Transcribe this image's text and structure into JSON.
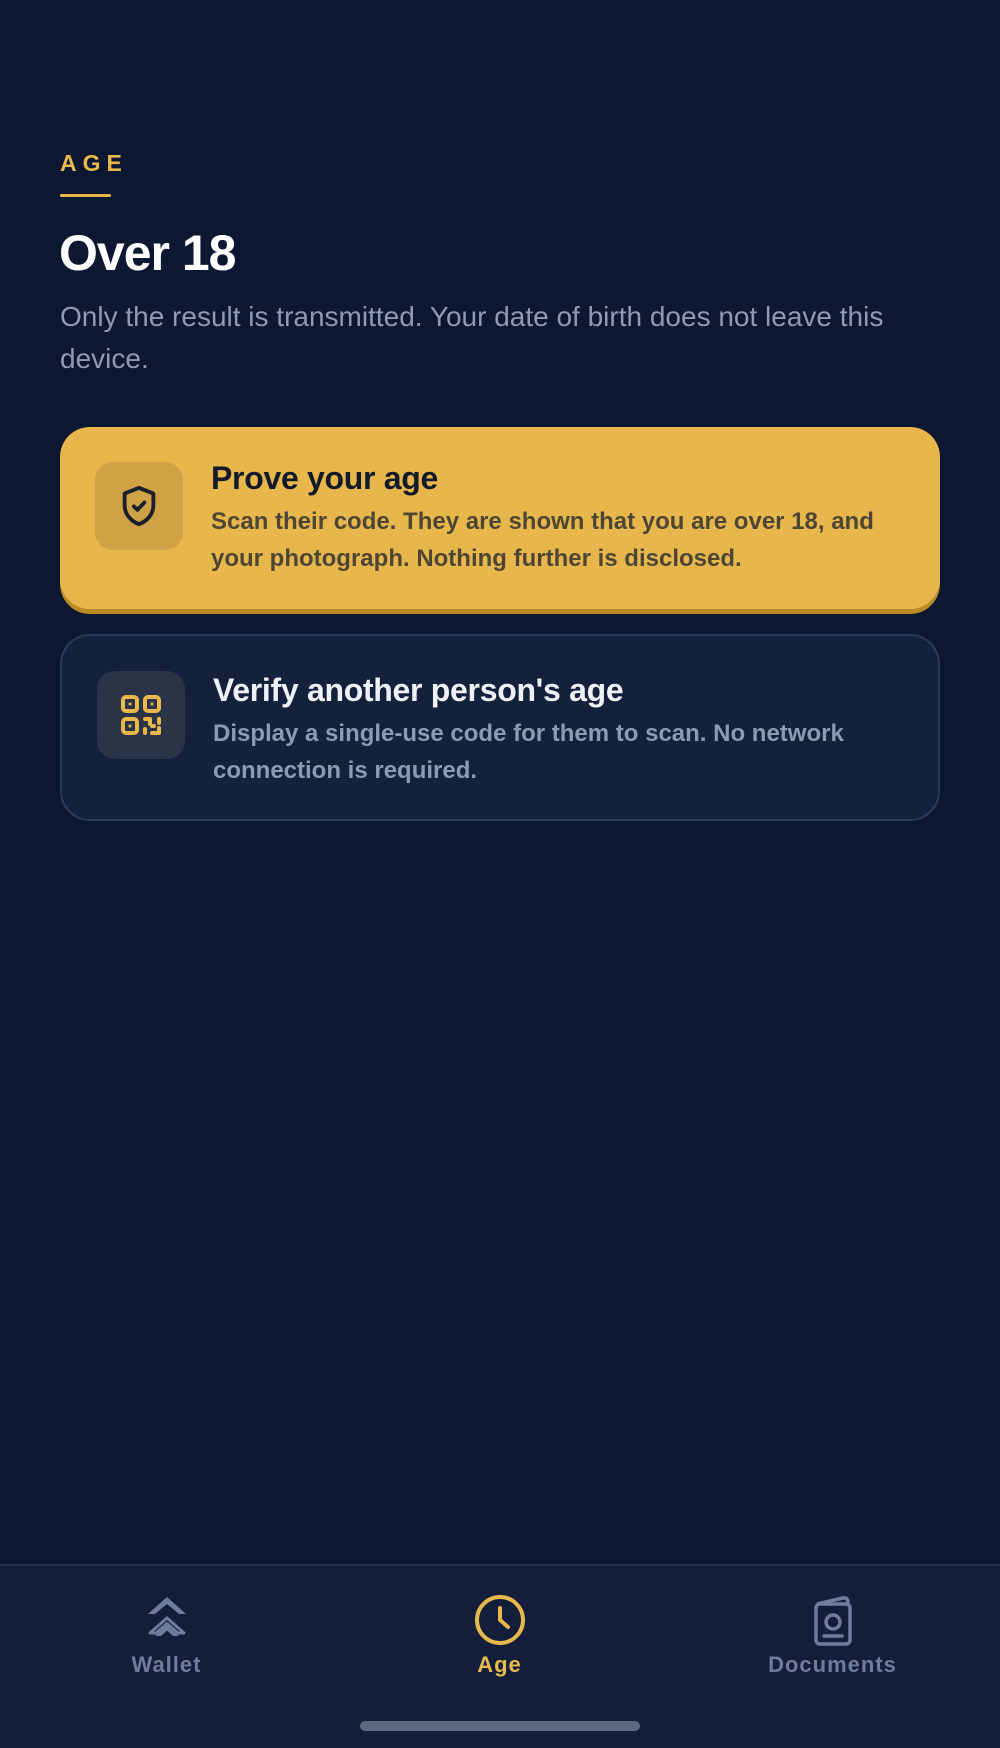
{
  "header": {
    "section_label": "AGE",
    "title": "Over 18",
    "subtitle": "Only the result is transmitted. Your date of birth does not leave this device."
  },
  "cards": [
    {
      "title": "Prove your age",
      "description": "Scan their code. They are shown that you are over 18, and your photograph. Nothing further is disclosed.",
      "icon": "shield-check-icon"
    },
    {
      "title": "Verify another person's age",
      "description": "Display a single-use code for them to scan. No network connection is required.",
      "icon": "qr-code-icon"
    }
  ],
  "nav": {
    "items": [
      {
        "label": "Wallet",
        "icon": "chevrons-up-icon",
        "active": false
      },
      {
        "label": "Age",
        "icon": "clock-icon",
        "active": true
      },
      {
        "label": "Documents",
        "icon": "passport-icon",
        "active": false
      }
    ]
  },
  "colors": {
    "background": "#0c1731",
    "accent": "#e8b84b",
    "card_secondary": "#13213d",
    "muted_text": "#8e9bb6",
    "nav_inactive": "#6f7d9a"
  }
}
